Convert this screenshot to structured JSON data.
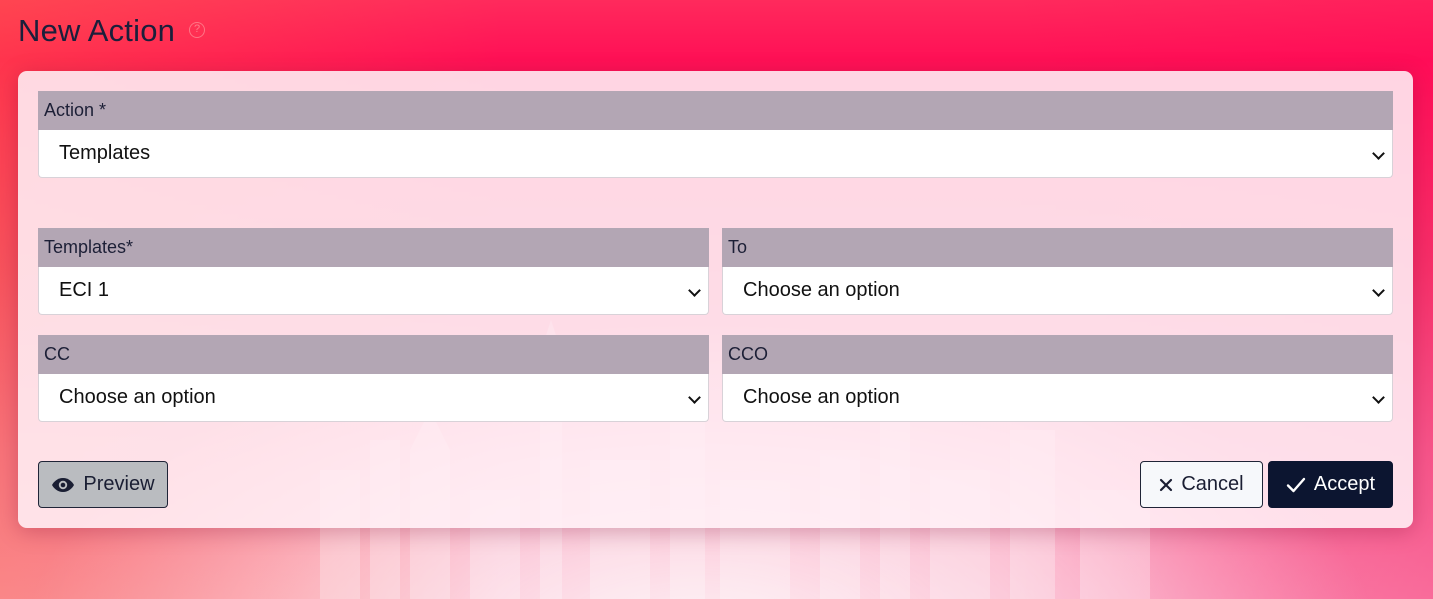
{
  "page": {
    "title": "New Action",
    "help_icon": "question-circle-icon"
  },
  "form": {
    "action": {
      "label": "Action *",
      "value": "Templates"
    },
    "templates": {
      "label": "Templates*",
      "value": "ECI 1"
    },
    "to": {
      "label": "To",
      "value": "Choose an option"
    },
    "cc": {
      "label": "CC",
      "value": "Choose an option"
    },
    "cco": {
      "label": "CCO",
      "value": "Choose an option"
    }
  },
  "buttons": {
    "preview": {
      "label": "Preview",
      "icon": "eye-icon"
    },
    "cancel": {
      "label": "Cancel",
      "icon": "close-icon"
    },
    "accept": {
      "label": "Accept",
      "icon": "check-icon"
    }
  },
  "colors": {
    "label_bg": "#b3a6b4",
    "accept_bg": "#0c1530",
    "background_accent": "#ff1056"
  }
}
